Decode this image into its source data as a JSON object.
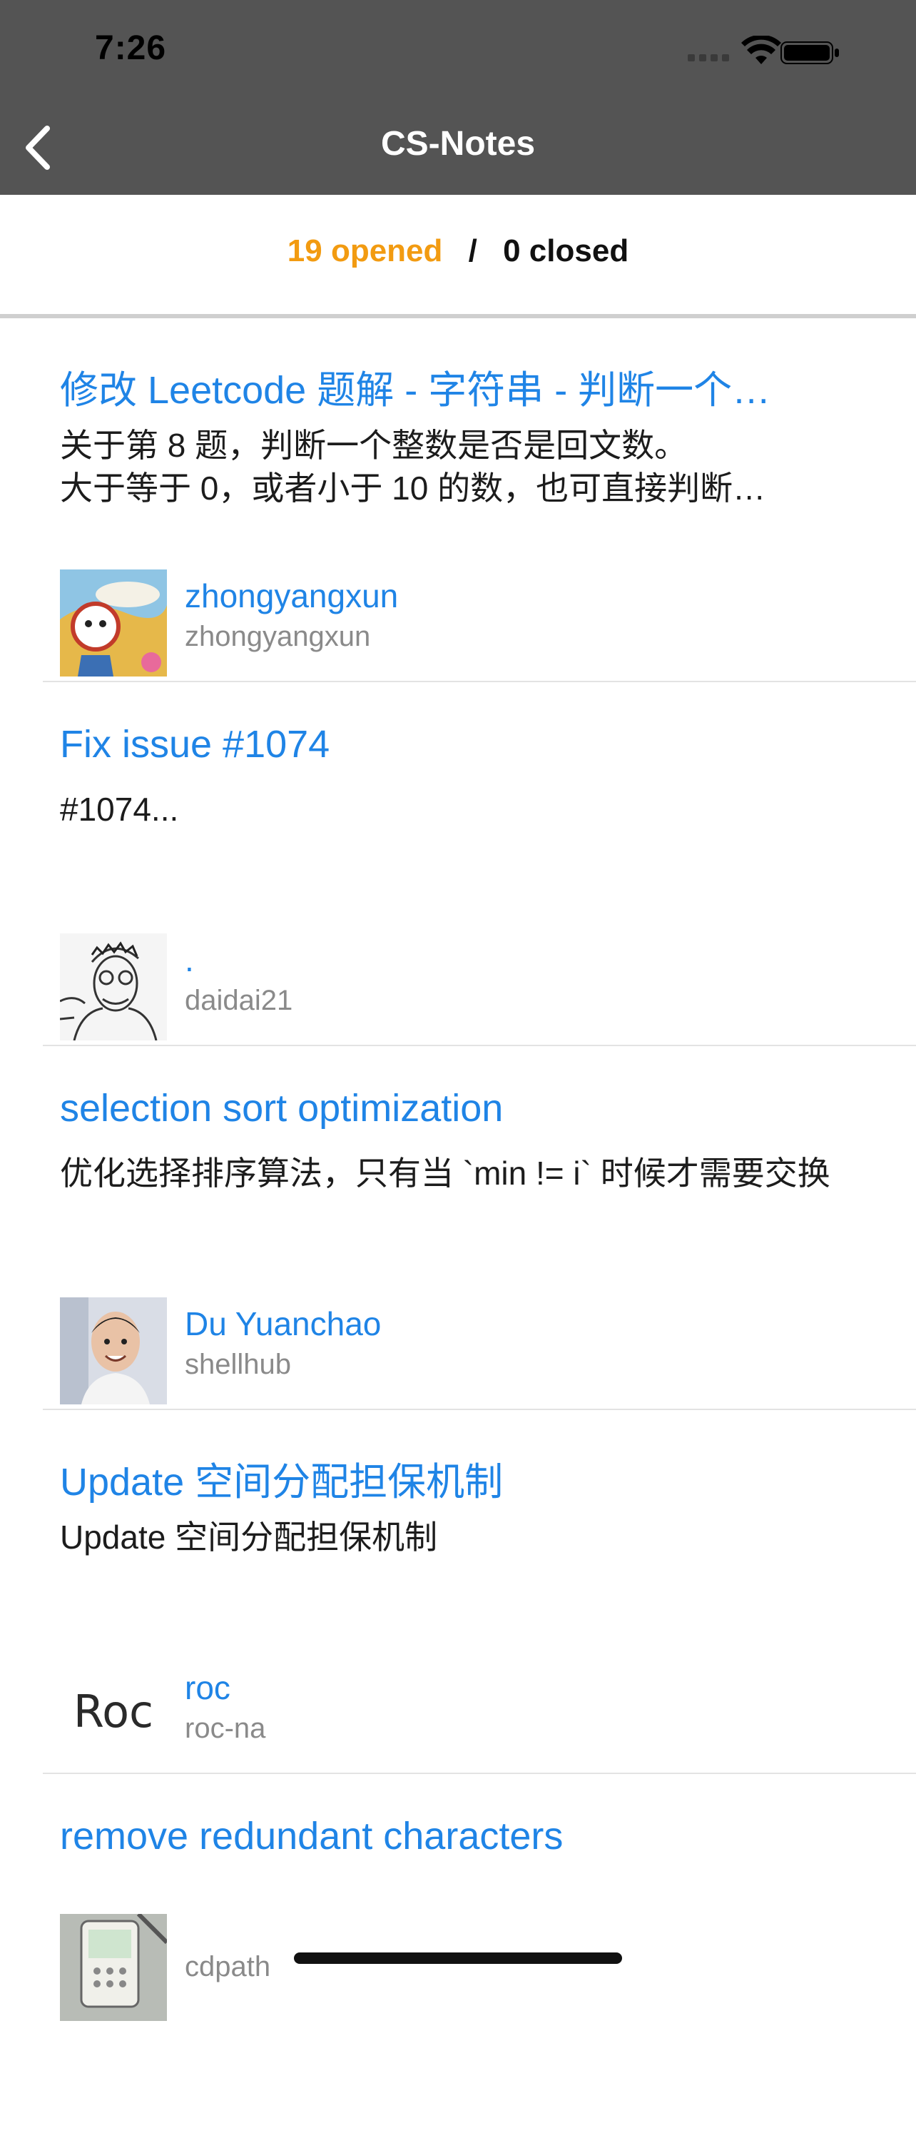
{
  "status_bar": {
    "time": "7:26",
    "icons": [
      "signal-icon",
      "wifi-icon",
      "battery-icon"
    ]
  },
  "nav": {
    "title": "CS-Notes",
    "back_icon": "chevron-left-icon"
  },
  "filter": {
    "opened_label": "19 opened",
    "separator": "/",
    "closed_label": "0 closed",
    "opened_color": "#f29b11"
  },
  "colors": {
    "header_bg": "#545454",
    "link_blue": "#1f84e6",
    "secondary_gray": "#8a8a8a"
  },
  "issues": [
    {
      "title": "修改 Leetcode 题解 - 字符串 - 判断一个…",
      "body": "关于第 8 题，判断一个整数是否是回文数。\n大于等于 0，或者小于 10 的数，也可直接判断…",
      "user_name": "zhongyangxun",
      "user_login": "zhongyangxun"
    },
    {
      "title": "Fix issue #1074",
      "body": "#1074...",
      "user_name": ".",
      "user_login": "daidai21"
    },
    {
      "title": "selection sort optimization",
      "body": "优化选择排序算法，只有当 `min != i` 时候才需要交换",
      "user_name": "Du Yuanchao",
      "user_login": "shellhub"
    },
    {
      "title": "Update 空间分配担保机制",
      "body": "Update 空间分配担保机制",
      "user_name": "roc",
      "user_login": "roc-na",
      "avatar_text": "Roc"
    },
    {
      "title": "remove redundant characters",
      "body": "",
      "user_name": "",
      "user_login": "cdpath"
    }
  ]
}
